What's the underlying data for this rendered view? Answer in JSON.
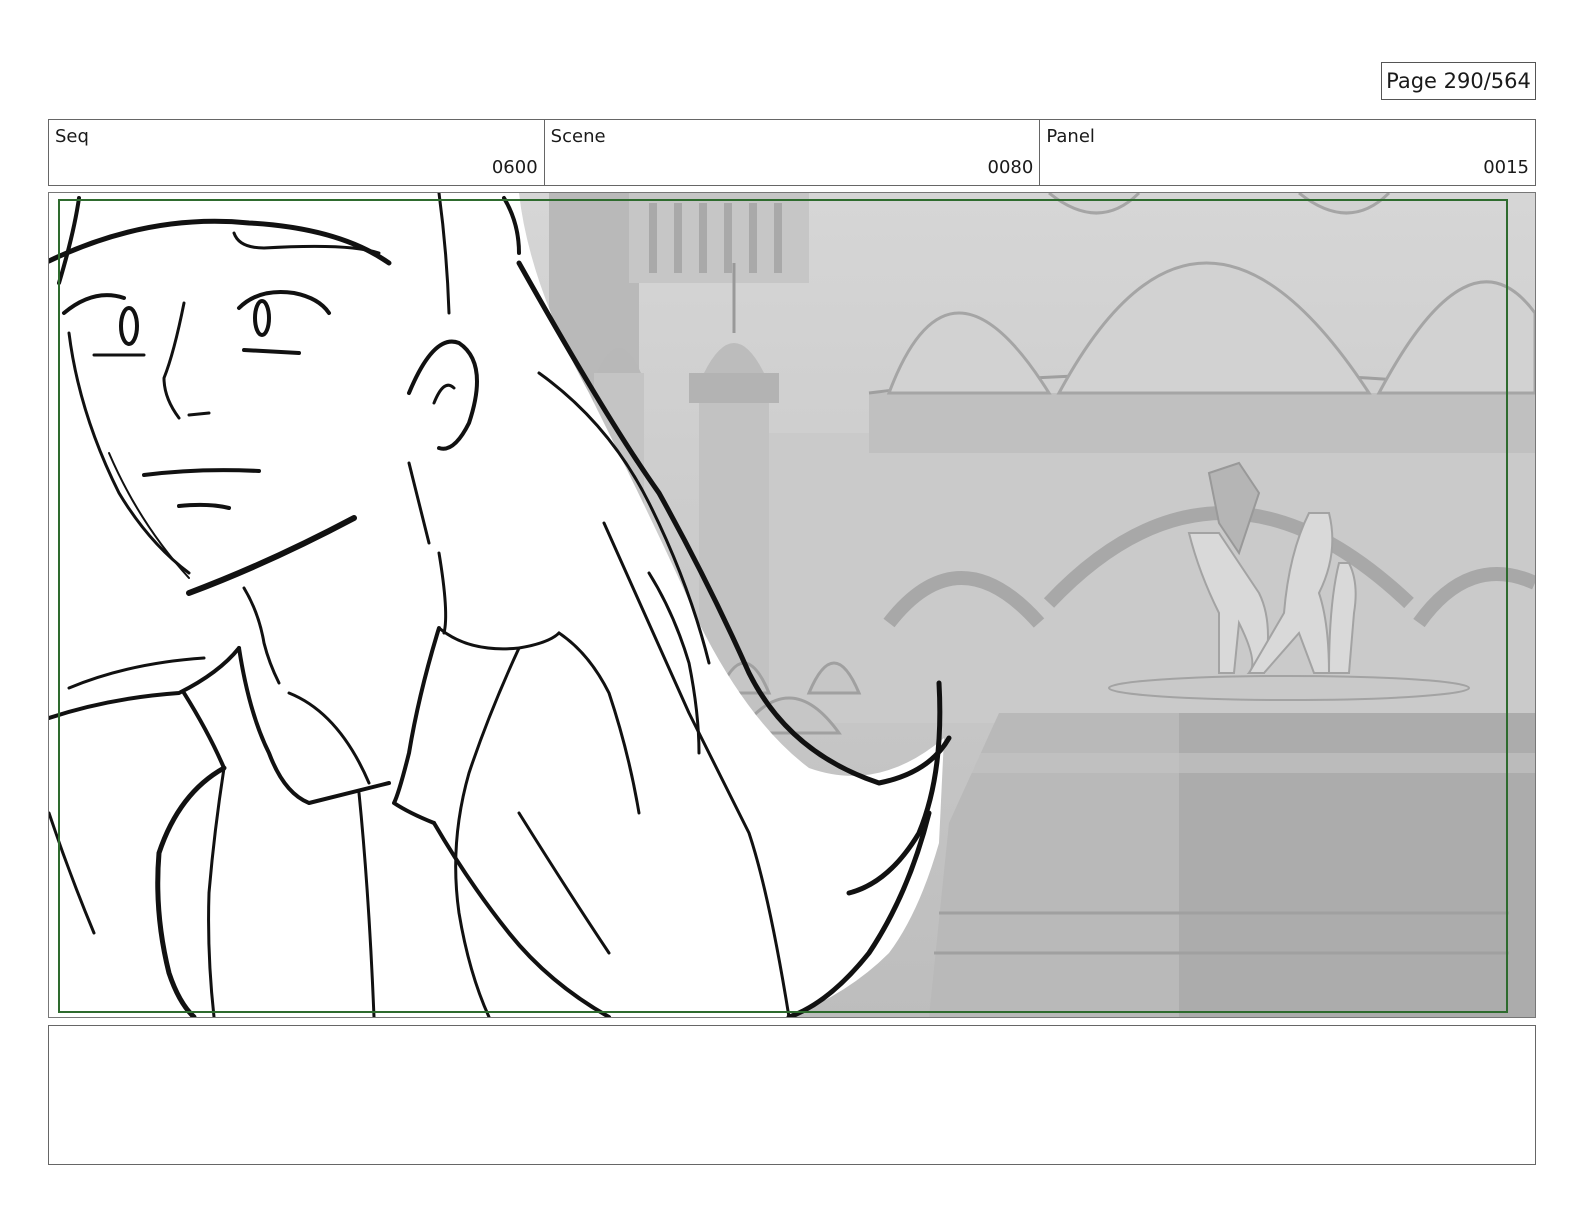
{
  "page": {
    "label": "Page 290/564"
  },
  "header": {
    "seq": {
      "label": "Seq",
      "value": "0600"
    },
    "scene": {
      "label": "Scene",
      "value": "0080"
    },
    "panel": {
      "label": "Panel",
      "value": "0015"
    }
  },
  "notes": {
    "text": ""
  },
  "colors": {
    "safe_frame": "#2e6b2e",
    "background_render": "#cfcfcf",
    "ink": "#111111"
  },
  "icons": [
    "storyboard-panel-image"
  ]
}
